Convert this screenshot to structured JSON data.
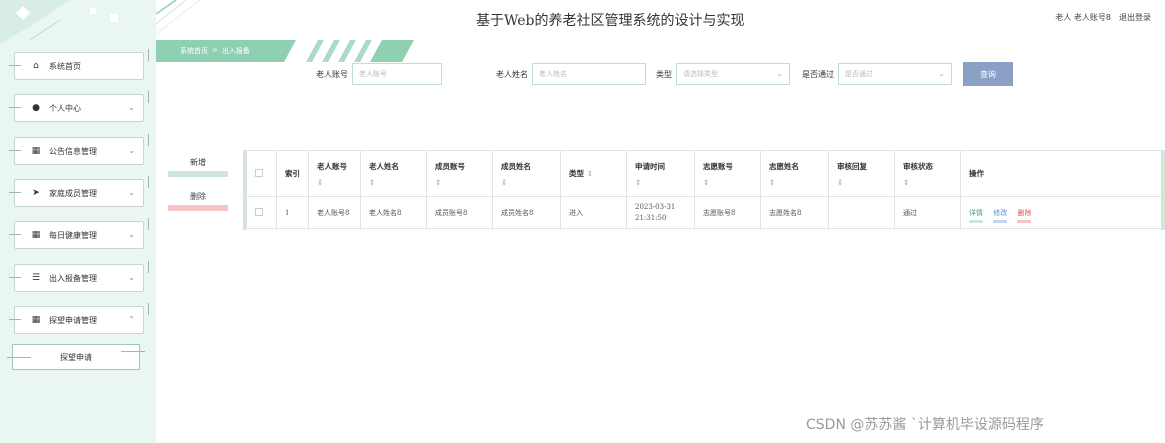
{
  "app": {
    "title": "基于Web的养老社区管理系统的设计与实现",
    "user_label": "老人 老人账号8",
    "logout": "退出登录"
  },
  "breadcrumb": {
    "home": "系统首页",
    "separator": ">",
    "current": "出入报备"
  },
  "sidebar": {
    "items": [
      {
        "label": "系统首页",
        "icon": "home-icon"
      },
      {
        "label": "个人中心",
        "icon": "user-icon"
      },
      {
        "label": "公告信息管理",
        "icon": "grid-icon"
      },
      {
        "label": "家庭成员管理",
        "icon": "send-icon"
      },
      {
        "label": "每日健康管理",
        "icon": "grid-icon"
      },
      {
        "label": "出入报备管理",
        "icon": "sliders-icon"
      },
      {
        "label": "探望申请管理",
        "icon": "grid-icon"
      }
    ],
    "sub_item": "探望申请"
  },
  "search": {
    "elder_account_label": "老人账号",
    "elder_account_placeholder": "老人账号",
    "elder_name_label": "老人姓名",
    "elder_name_placeholder": "老人姓名",
    "type_label": "类型",
    "type_placeholder": "请选择类型",
    "approved_label": "是否通过",
    "approved_placeholder": "是否通过",
    "query_button": "查询"
  },
  "actions": {
    "add": "新增",
    "delete": "删除"
  },
  "table": {
    "headers": [
      "索引",
      "老人账号",
      "老人姓名",
      "成员账号",
      "成员姓名",
      "类型",
      "申请时间",
      "志愿账号",
      "志愿姓名",
      "审核回复",
      "审核状态",
      "操作"
    ],
    "sort_glyph": "⇕",
    "rows": [
      {
        "index": "1",
        "elder_account": "老人账号8",
        "elder_name": "老人姓名8",
        "member_account": "成员账号8",
        "member_name": "成员姓名8",
        "type": "进入",
        "apply_date": "2023-03-31",
        "apply_time": "21:31:50",
        "volunteer_account": "志愿账号8",
        "volunteer_name": "志愿姓名8",
        "review_reply": "",
        "review_status": "通过",
        "ops": {
          "detail": "详情",
          "edit": "修改",
          "delete": "删除"
        }
      }
    ]
  },
  "watermark": "CSDN @苏苏酱 `计算机毕设源码程序",
  "colors": {
    "accent": "#8fd0b2",
    "query_button": "#8aa0c4",
    "sidebar_bg": "#eaf6f1"
  }
}
